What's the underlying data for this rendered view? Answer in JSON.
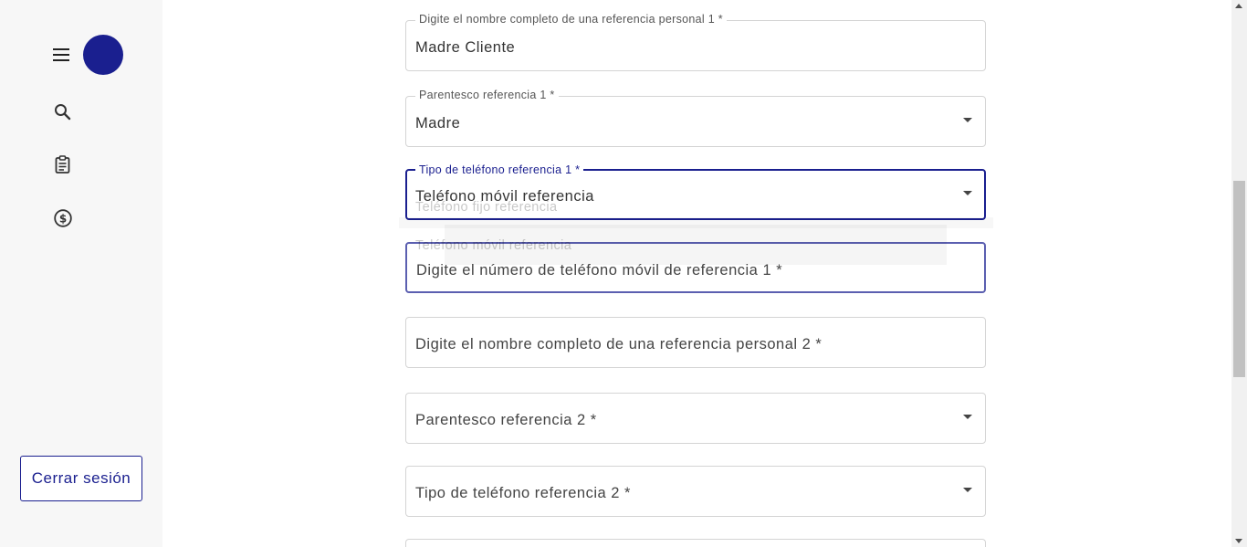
{
  "sidebar": {
    "icons": [
      "menu-icon",
      "search-icon",
      "clipboard-icon",
      "dollar-icon"
    ],
    "logout_label": "Cerrar sesión"
  },
  "form": {
    "ref1_name": {
      "label": "Digite el nombre completo de una referencia personal 1 *",
      "value": "Madre Cliente"
    },
    "ref1_relationship": {
      "label": "Parentesco referencia 1 *",
      "value": "Madre"
    },
    "ref1_phone_type": {
      "label": "Tipo de teléfono referencia 1 *",
      "value": "Teléfono móvil referencia",
      "options": [
        "Teléfono fijo referencia",
        "Teléfono móvil referencia"
      ]
    },
    "ref1_phone_number": {
      "placeholder": "Digite el número de teléfono móvil de referencia 1 *"
    },
    "ref2_name": {
      "placeholder": "Digite el nombre completo de una referencia personal 2 *"
    },
    "ref2_relationship": {
      "placeholder": "Parentesco referencia 2 *"
    },
    "ref2_phone_type": {
      "placeholder": "Tipo de teléfono referencia 2 *"
    }
  },
  "colors": {
    "accent": "#1a1f8f",
    "sidebar_bg": "#f7f7f7"
  }
}
